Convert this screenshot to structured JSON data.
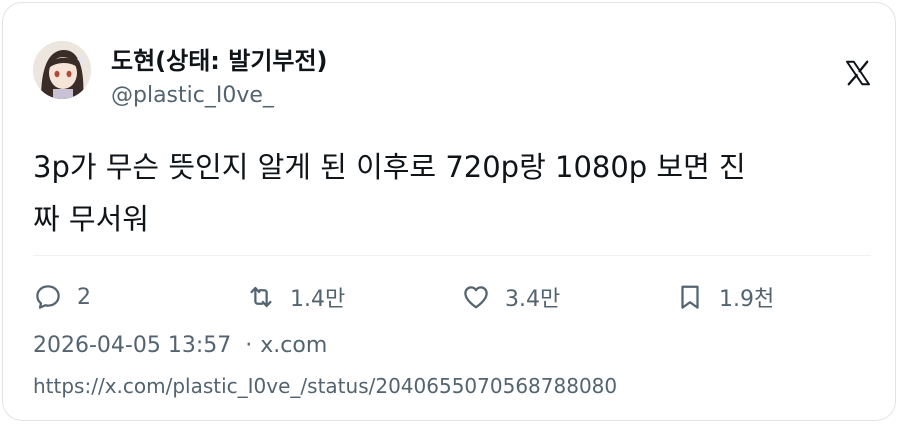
{
  "tweet": {
    "display_name": "도현(상태: 발기부전)",
    "handle": "@plastic_I0ve_",
    "text_lines": [
      "3p가 무슨 뜻인지 알게 된 이후로 720p랑 1080p 보면 진",
      "짜 무서워"
    ],
    "stats": {
      "replies": "2",
      "retweets": "1.4만",
      "likes": "3.4만",
      "bookmarks": "1.9천"
    },
    "timestamp": "2026-04-05 13:57",
    "separator": "·",
    "source": "x.com",
    "url": "https://x.com/plastic_I0ve_/status/2040655070568788080"
  },
  "icons": {
    "logo": "x-logo-icon",
    "reply": "reply-bubble-icon",
    "retweet": "retweet-icon",
    "like": "heart-icon",
    "bookmark": "bookmark-icon"
  },
  "colors": {
    "text": "#0f1419",
    "muted": "#536471",
    "border": "#e1e4e6"
  }
}
